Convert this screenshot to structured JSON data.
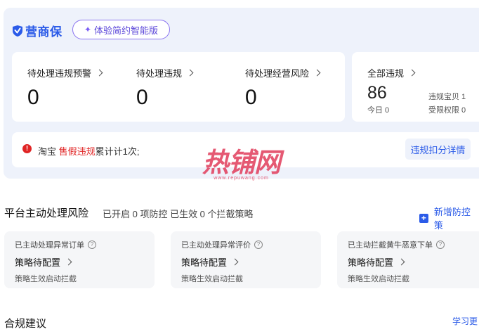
{
  "header": {
    "logo_text": "营商保",
    "smart_button": "体验简约智能版"
  },
  "metrics": [
    {
      "label": "待处理违规预警",
      "value": "0"
    },
    {
      "label": "待处理违规",
      "value": "0"
    },
    {
      "label": "待处理经营风险",
      "value": "0"
    }
  ],
  "all_violations": {
    "label": "全部违规",
    "value": "86",
    "today": "今日 0",
    "points_label": "违规宝贝 1",
    "restricted_label": "受限权限 0"
  },
  "notice": {
    "prefix": "淘宝",
    "highlight": "售假违规",
    "suffix": "累计计1次;",
    "detail_button": "违规扣分详情"
  },
  "watermark": {
    "main": "热铺网",
    "sub": "www.repuwang.com"
  },
  "risk_section": {
    "title": "平台主动处理风险",
    "subtitle": "已开启 0 项防控 已生效 0 个拦截策略",
    "add_link": "新增防控策"
  },
  "policies": [
    {
      "label": "已主动处理异常订单",
      "status": "策略待配置",
      "desc": "策略生效启动拦截"
    },
    {
      "label": "已主动处理异常评价",
      "status": "策略待配置",
      "desc": "策略生效启动拦截"
    },
    {
      "label": "已主动拦截黄牛恶意下单",
      "status": "策略待配置",
      "desc": "策略生效启动拦截"
    }
  ],
  "compliance": {
    "title": "合规建议",
    "learn_link": "学习更"
  },
  "colors": {
    "brand_blue": "#2b5be8",
    "alert_red": "#e02424",
    "panel_bg": "#eef2fb"
  }
}
